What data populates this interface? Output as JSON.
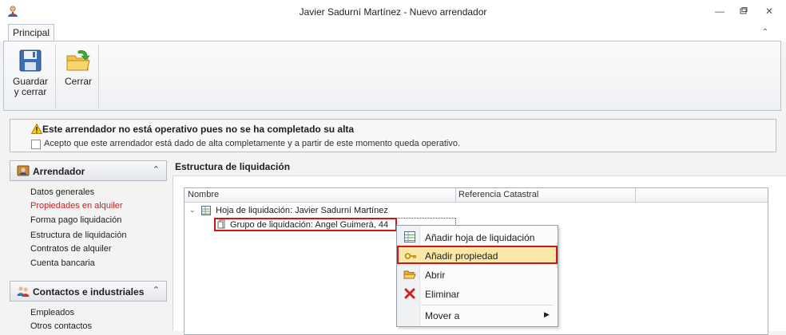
{
  "window": {
    "title": "Javier Sadurní Martínez - Nuevo arrendador",
    "minimize_icon": "minimize-icon",
    "restore_icon": "restore-icon",
    "close_icon": "close-icon"
  },
  "ribbon": {
    "tab_label": "Principal",
    "buttons": [
      {
        "label_line1": "Guardar",
        "label_line2": "y cerrar",
        "icon": "floppy-disk-icon"
      },
      {
        "label_line1": "Cerrar",
        "label_line2": "",
        "icon": "folder-exit-icon"
      }
    ]
  },
  "warning": {
    "title": "Este arrendador no está operativo pues no se ha completado su alta",
    "checkbox_label": "Acepto que este arrendador está dado de alta completamente y a partir de este momento queda operativo.",
    "checked": false
  },
  "sidebar": {
    "groups": [
      {
        "title": "Arrendador",
        "icon": "person-card-icon",
        "items": [
          {
            "label": "Datos generales",
            "active": false
          },
          {
            "label": "Propiedades en alquiler",
            "active": true
          },
          {
            "label": "Forma pago liquidación",
            "active": false
          },
          {
            "label": "Estructura de liquidación",
            "active": false
          },
          {
            "label": "Contratos de alquiler",
            "active": false
          },
          {
            "label": "Cuenta bancaria",
            "active": false
          }
        ]
      },
      {
        "title": "Contactos e industriales",
        "icon": "contacts-icon",
        "items": [
          {
            "label": "Empleados",
            "active": false
          },
          {
            "label": "Otros contactos",
            "active": false
          }
        ]
      }
    ]
  },
  "main": {
    "title": "Estructura de liquidación",
    "columns": [
      "Nombre",
      "Referencia Catastral",
      ""
    ],
    "tree": {
      "root": "Hoja de liquidación: Javier Sadurní Martínez",
      "child": "Grupo de liquidación: Angel Guimerà, 44"
    }
  },
  "context_menu": {
    "items": [
      {
        "label": "Añadir hoja de liquidación",
        "icon": "sheet-icon"
      },
      {
        "label": "Añadir propiedad",
        "icon": "key-icon"
      },
      {
        "label": "Abrir",
        "icon": "open-folder-icon"
      },
      {
        "label": "Eliminar",
        "icon": "delete-x-icon"
      },
      {
        "label": "Mover a",
        "icon": ""
      }
    ]
  },
  "colors": {
    "active_nav": "#c8221f",
    "highlight_border": "#d0151a",
    "highlight_fill": "#fbe8a8"
  }
}
